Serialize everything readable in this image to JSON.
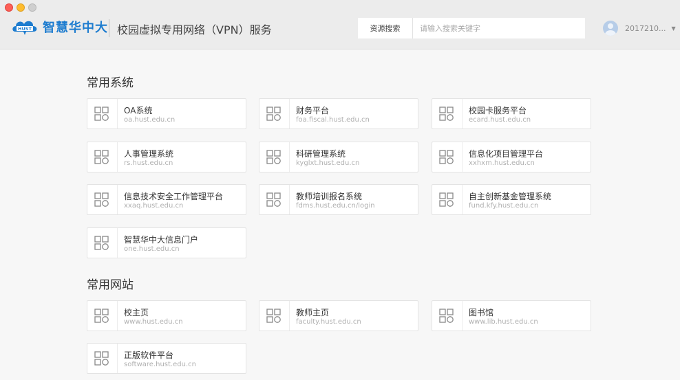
{
  "header": {
    "logo_text": "智慧华中大",
    "logo_badge": "HUST",
    "app_title": "校园虚拟专用网络（VPN）服务",
    "search": {
      "button_label": "资源搜索",
      "placeholder": "请输入搜索关键字",
      "value": ""
    },
    "user": {
      "name": "2017210...",
      "avatar_icon": "user-avatar-icon",
      "caret_icon": "chevron-down-icon"
    }
  },
  "sections": [
    {
      "title": "常用系统",
      "items": [
        {
          "name": "OA系统",
          "url": "oa.hust.edu.cn"
        },
        {
          "name": "财务平台",
          "url": "foa.fiscal.hust.edu.cn"
        },
        {
          "name": "校园卡服务平台",
          "url": "ecard.hust.edu.cn"
        },
        {
          "name": "人事管理系统",
          "url": "rs.hust.edu.cn"
        },
        {
          "name": "科研管理系统",
          "url": "kyglxt.hust.edu.cn"
        },
        {
          "name": "信息化项目管理平台",
          "url": "xxhxm.hust.edu.cn"
        },
        {
          "name": "信息技术安全工作管理平台",
          "url": "xxaq.hust.edu.cn"
        },
        {
          "name": "教师培训报名系统",
          "url": "fdms.hust.edu.cn/login"
        },
        {
          "name": "自主创新基金管理系统",
          "url": "fund.kfy.hust.edu.cn"
        },
        {
          "name": "智慧华中大信息门户",
          "url": "one.hust.edu.cn"
        }
      ]
    },
    {
      "title": "常用网站",
      "items": [
        {
          "name": "校主页",
          "url": "www.hust.edu.cn"
        },
        {
          "name": "教师主页",
          "url": "faculty.hust.edu.cn"
        },
        {
          "name": "图书馆",
          "url": "www.lib.hust.edu.cn"
        },
        {
          "name": "正版软件平台",
          "url": "software.hust.edu.cn"
        }
      ]
    }
  ],
  "colors": {
    "brand": "#1d7ccf",
    "background": "#f7f7f7",
    "header": "#ececec"
  },
  "icons": {
    "card": "app-grid-icon"
  }
}
